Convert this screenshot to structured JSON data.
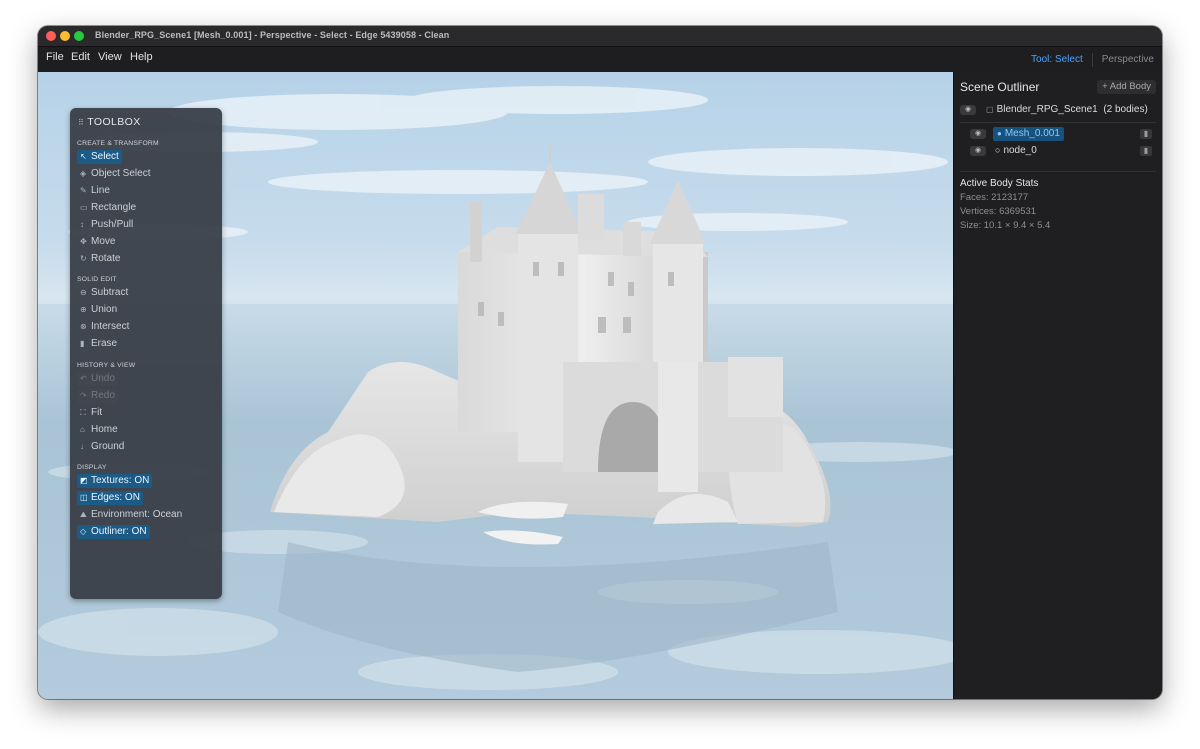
{
  "window": {
    "title": "Blender_RPG_Scene1 [Mesh_0.001] - Perspective - Select - Edge 5439058 - Clean"
  },
  "menubar": {
    "items": [
      "File",
      "Edit",
      "View",
      "Help"
    ],
    "tool_status": "Tool: Select",
    "view_status": "Perspective"
  },
  "toolbox": {
    "title": "TOOLBOX",
    "sections": [
      {
        "label": "CREATE & TRANSFORM",
        "items": [
          {
            "label": "Select",
            "icon": "cursor-icon",
            "state": "active"
          },
          {
            "label": "Object Select",
            "icon": "cube-icon",
            "state": "normal"
          },
          {
            "label": "Line",
            "icon": "pencil-icon",
            "state": "normal"
          },
          {
            "label": "Rectangle",
            "icon": "rectangle-icon",
            "state": "normal"
          },
          {
            "label": "Push/Pull",
            "icon": "push-pull-icon",
            "state": "normal"
          },
          {
            "label": "Move",
            "icon": "move-icon",
            "state": "normal"
          },
          {
            "label": "Rotate",
            "icon": "rotate-icon",
            "state": "normal"
          }
        ]
      },
      {
        "label": "SOLID EDIT",
        "items": [
          {
            "label": "Subtract",
            "icon": "subtract-icon",
            "state": "normal"
          },
          {
            "label": "Union",
            "icon": "union-icon",
            "state": "normal"
          },
          {
            "label": "Intersect",
            "icon": "intersect-icon",
            "state": "normal"
          },
          {
            "label": "Erase",
            "icon": "trash-icon",
            "state": "normal"
          }
        ]
      },
      {
        "label": "HISTORY & VIEW",
        "items": [
          {
            "label": "Undo",
            "icon": "undo-icon",
            "state": "disabled"
          },
          {
            "label": "Redo",
            "icon": "redo-icon",
            "state": "disabled"
          },
          {
            "label": "Fit",
            "icon": "fit-icon",
            "state": "normal"
          },
          {
            "label": "Home",
            "icon": "home-icon",
            "state": "normal"
          },
          {
            "label": "Ground",
            "icon": "ground-icon",
            "state": "normal"
          }
        ]
      },
      {
        "label": "DISPLAY",
        "items": [
          {
            "label": "Textures: ON",
            "icon": "texture-icon",
            "state": "active"
          },
          {
            "label": "Edges: ON",
            "icon": "edges-icon",
            "state": "active"
          },
          {
            "label": "Environment: Ocean",
            "icon": "environment-icon",
            "state": "normal"
          },
          {
            "label": "Outliner: ON",
            "icon": "outliner-icon",
            "state": "active"
          }
        ]
      }
    ]
  },
  "outliner": {
    "title": "Scene Outliner",
    "add_body_label": "+ Add Body",
    "scene": {
      "name": "Blender_RPG_Scene1",
      "count": "(2 bodies)"
    },
    "bodies": [
      {
        "name": "Mesh_0.001",
        "selected": true
      },
      {
        "name": "node_0",
        "selected": false
      }
    ]
  },
  "stats": {
    "title": "Active Body Stats",
    "faces": "Faces: 2123177",
    "vertices": "Vertices: 6369531",
    "size": "Size: 10.1 × 9.4 × 5.4"
  },
  "colors": {
    "accent": "#4aa3ff",
    "selection": "#1c5b86",
    "toolbox_bg": "#343942",
    "sidebar_bg": "#1f1f21"
  }
}
